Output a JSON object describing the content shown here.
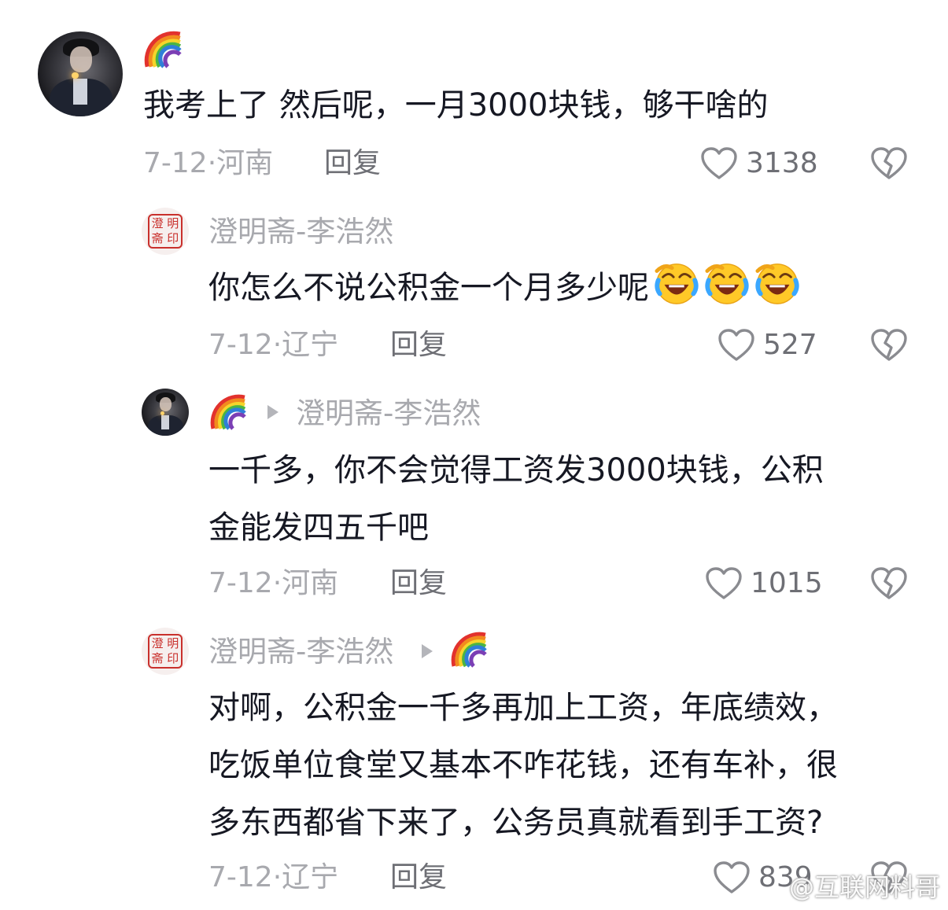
{
  "comments": [
    {
      "author": "🌈",
      "text": [
        "我考上了 然后呢，一月3000块钱，够干啥的"
      ],
      "date": "7-12",
      "location": "河南",
      "reply_label": "回复",
      "likes": "3138"
    },
    {
      "author": "澄明斋-李浩然",
      "text": [
        "你怎么不说公积金一个月多少呢"
      ],
      "emoji": [
        "face-with-tears-of-joy",
        "face-with-tears-of-joy",
        "face-with-tears-of-joy"
      ],
      "date": "7-12",
      "location": "辽宁",
      "reply_label": "回复",
      "likes": "527"
    },
    {
      "author": "🌈",
      "reply_to": "澄明斋-李浩然",
      "text": [
        "一千多，你不会觉得工资发3000块钱，公积",
        "金能发四五千吧"
      ],
      "date": "7-12",
      "location": "河南",
      "reply_label": "回复",
      "likes": "1015"
    },
    {
      "author": "澄明斋-李浩然",
      "reply_to": "🌈",
      "text": [
        "对啊，公积金一千多再加上工资，年底绩效，",
        "吃饭单位食堂又基本不咋花钱，还有车补，很",
        "多东西都省下来了，公务员真就看到手工资?"
      ],
      "date": "7-12",
      "location": "辽宁",
      "reply_label": "回复",
      "likes": "839"
    }
  ],
  "seal_text": [
    "澄",
    "明",
    "斋",
    "印"
  ],
  "meta_separator": "·",
  "watermark": "@互联网料哥",
  "icons": [
    "heart-outline-icon",
    "broken-heart-icon",
    "rainbow-icon",
    "triangle-right-icon"
  ],
  "colors": {
    "text": "#161823",
    "secondary": "#a8a9ae",
    "action": "#6e6f75",
    "seal": "#c9302c"
  }
}
